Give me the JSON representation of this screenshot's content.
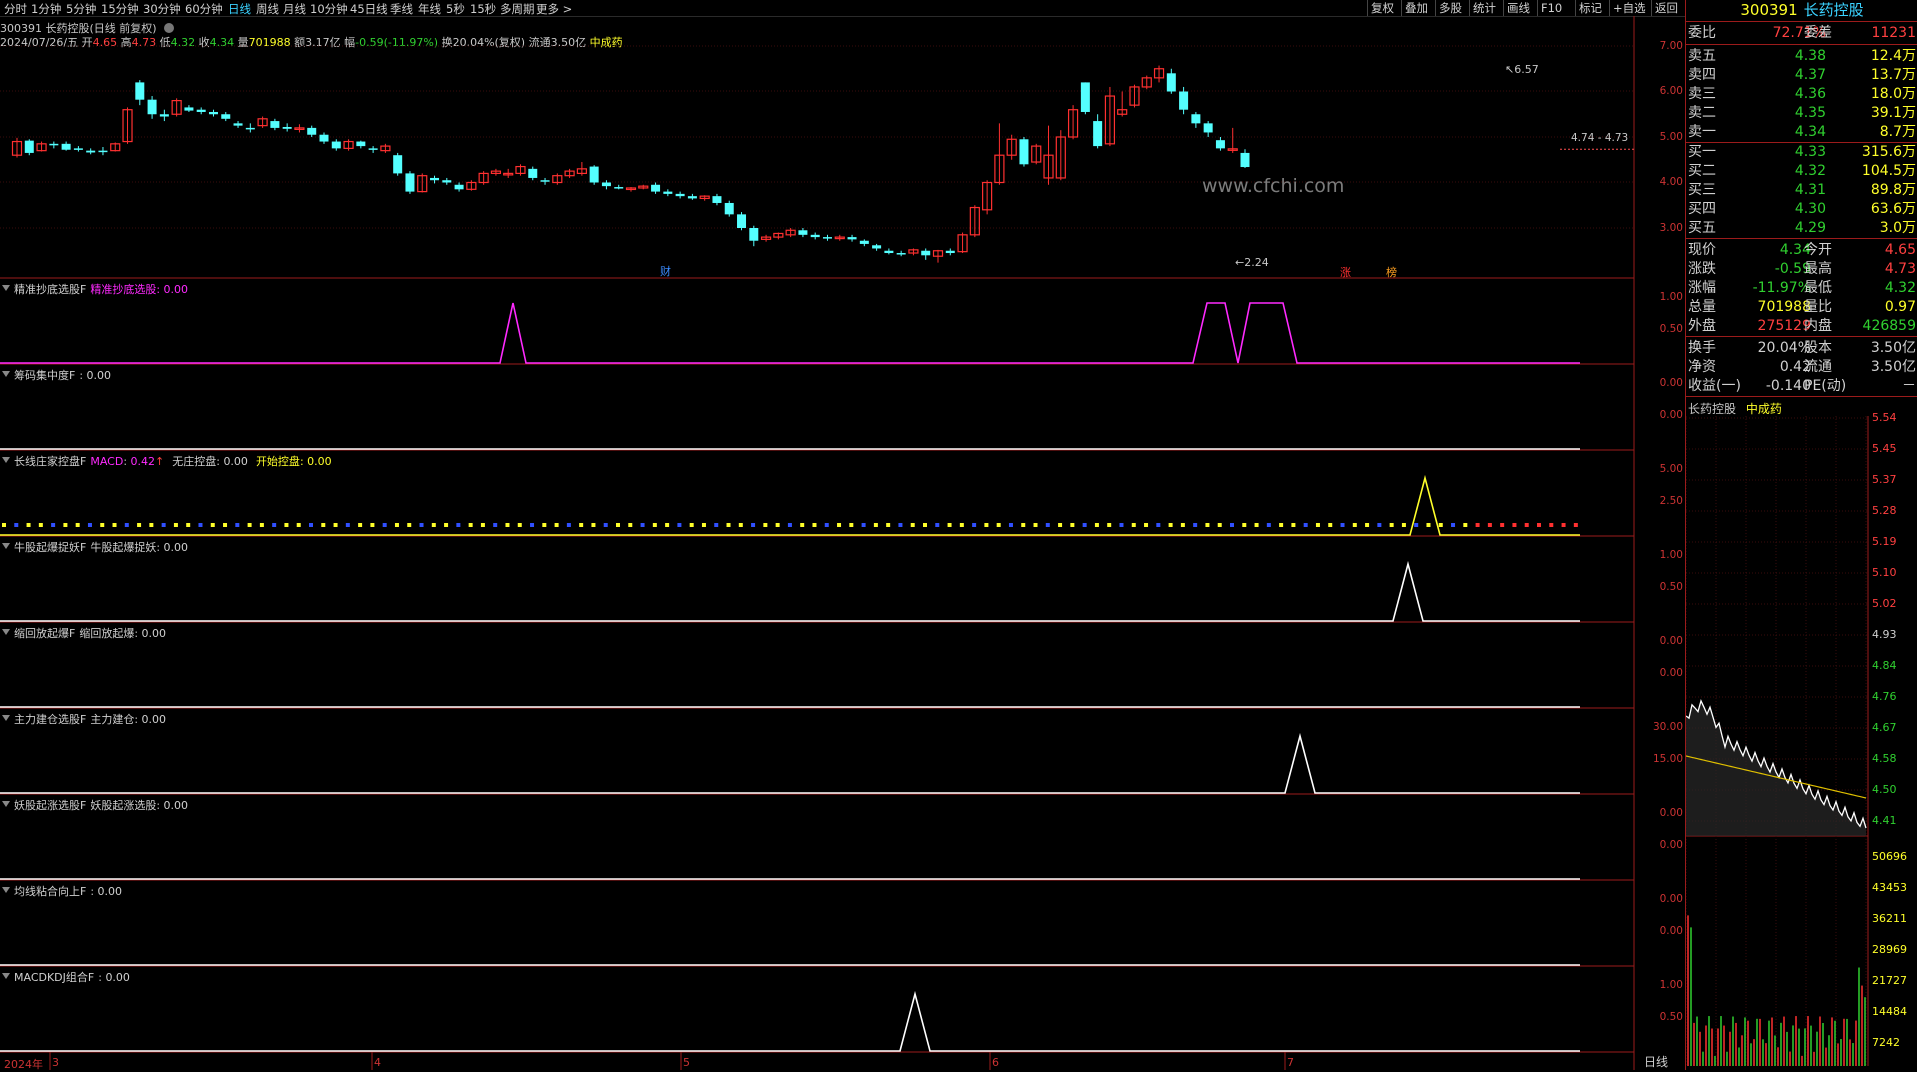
{
  "toolbar": {
    "timeframes": [
      "分时",
      "1分钟",
      "5分钟",
      "15分钟",
      "30分钟",
      "60分钟",
      "日线",
      "周线",
      "月线",
      "10分钟",
      "45日线",
      "季线",
      "年线",
      "5秒",
      "15秒",
      "多周期",
      "更多"
    ],
    "active_timeframe": "日线",
    "right_buttons": [
      "复权",
      "叠加",
      "多股",
      "统计",
      "画线",
      "F10",
      "标记",
      "+自选",
      "返回"
    ]
  },
  "header": {
    "title_line": "300391 长药控股(日线 前复权)",
    "date": "2024/07/26/五",
    "open_label": "开",
    "open": "4.65",
    "high_label": "高",
    "high": "4.73",
    "low_label": "低",
    "low": "4.32",
    "close_label": "收",
    "close": "4.34",
    "vol_label": "量",
    "vol": "701988",
    "amount": "额3.17亿",
    "change_label": "幅",
    "change": "-0.59(-11.97%)",
    "turnover": "换20.04%(复权)",
    "float": "流通3.50亿",
    "sector": "中成药"
  },
  "main_chart": {
    "watermark": "www.cfchi.com",
    "y_ticks": [
      "7.00",
      "6.00",
      "5.00",
      "4.00",
      "3.00"
    ],
    "high_note": "6.57",
    "low_note": "2.24",
    "last_note": "4.74 - 4.73",
    "marker_cai": "财",
    "marker_zhang": "涨",
    "marker_bang": "榜"
  },
  "indicators": [
    {
      "name": "精准抄底选股F",
      "label": "精准抄底选股",
      "value": "0.00",
      "ticks": [
        "1.00",
        "0.50"
      ],
      "color": "#ff2aff"
    },
    {
      "name": "筹码集中度F",
      "label": "",
      "value": "0.00",
      "ticks": [
        "0.00",
        "0.00"
      ],
      "color": "#ffffff"
    },
    {
      "name": "长线庄家控盘F",
      "label": "MACD",
      "value": "0.42",
      "arrow": "↑",
      "label2": "无庄控盘",
      "value2": "0.00",
      "label3": "开始控盘",
      "value3": "0.00",
      "ticks": [
        "5.00",
        "2.50"
      ],
      "color": "#ffff2a"
    },
    {
      "name": "牛股起爆捉妖F",
      "label": "牛股起爆捉妖",
      "value": "0.00",
      "ticks": [
        "1.00",
        "0.50"
      ],
      "color": "#ffffff"
    },
    {
      "name": "缩回放起爆F",
      "label": "缩回放起爆",
      "value": "0.00",
      "ticks": [
        "0.00",
        "0.00"
      ],
      "color": "#ffffff"
    },
    {
      "name": "主力建仓选股F",
      "label": "主力建仓",
      "value": "0.00",
      "ticks": [
        "30.00",
        "15.00"
      ],
      "color": "#ffffff"
    },
    {
      "name": "妖股起涨选股F",
      "label": "妖股起涨选股",
      "value": "0.00",
      "ticks": [
        "0.00",
        "0.00"
      ],
      "color": "#ffffff"
    },
    {
      "name": "均线粘合向上F",
      "label": "",
      "value": "0.00",
      "ticks": [
        "0.00",
        "0.00"
      ],
      "color": "#ffffff"
    },
    {
      "name": "MACDKDJ组合F",
      "label": "",
      "value": "0.00",
      "ticks": [
        "1.00",
        "0.50"
      ],
      "color": "#ffffff"
    }
  ],
  "bottom_axis": {
    "year": "2024年",
    "months": [
      "3",
      "4",
      "5",
      "6",
      "7"
    ],
    "period": "日线"
  },
  "quote_panel": {
    "code": "300391",
    "name": "长药控股",
    "weibi_label": "委比",
    "weibi": "72.71%",
    "weicha_label": "委差",
    "weicha": "11231",
    "asks": [
      {
        "label": "卖五",
        "price": "4.38",
        "vol": "12.4万"
      },
      {
        "label": "卖四",
        "price": "4.37",
        "vol": "13.7万"
      },
      {
        "label": "卖三",
        "price": "4.36",
        "vol": "18.0万"
      },
      {
        "label": "卖二",
        "price": "4.35",
        "vol": "39.1万"
      },
      {
        "label": "卖一",
        "price": "4.34",
        "vol": "8.7万"
      }
    ],
    "bids": [
      {
        "label": "买一",
        "price": "4.33",
        "vol": "315.6万"
      },
      {
        "label": "买二",
        "price": "4.32",
        "vol": "104.5万"
      },
      {
        "label": "买三",
        "price": "4.31",
        "vol": "89.8万"
      },
      {
        "label": "买四",
        "price": "4.30",
        "vol": "63.6万"
      },
      {
        "label": "买五",
        "price": "4.29",
        "vol": "3.0万"
      }
    ],
    "stats": [
      {
        "l1": "现价",
        "v1": "4.34",
        "l2": "今开",
        "v2": "4.65"
      },
      {
        "l1": "涨跌",
        "v1": "-0.59",
        "l2": "最高",
        "v2": "4.73"
      },
      {
        "l1": "涨幅",
        "v1": "-11.97%",
        "l2": "最低",
        "v2": "4.32"
      },
      {
        "l1": "总量",
        "v1": "701988",
        "l2": "量比",
        "v2": "0.97"
      },
      {
        "l1": "外盘",
        "v1": "275129",
        "l2": "内盘",
        "v2": "426859"
      }
    ],
    "stats2": [
      {
        "l1": "换手",
        "v1": "20.04%",
        "l2": "股本",
        "v2": "3.50亿"
      },
      {
        "l1": "净资",
        "v1": "0.42",
        "l2": "流通",
        "v2": "3.50亿"
      },
      {
        "l1": "收益(一)",
        "v1": "-0.140",
        "l2": "PE(动)",
        "v2": "－"
      }
    ],
    "mini_title": "长药控股",
    "mini_sector": "中成药",
    "mini_price_ticks": [
      "5.54",
      "5.45",
      "5.37",
      "5.28",
      "5.19",
      "5.10",
      "5.02",
      "4.93",
      "4.84",
      "4.76",
      "4.67",
      "4.58",
      "4.50",
      "4.41"
    ],
    "mini_vol_ticks": [
      "50696",
      "43453",
      "36211",
      "28969",
      "21727",
      "14484",
      "7242"
    ]
  }
}
